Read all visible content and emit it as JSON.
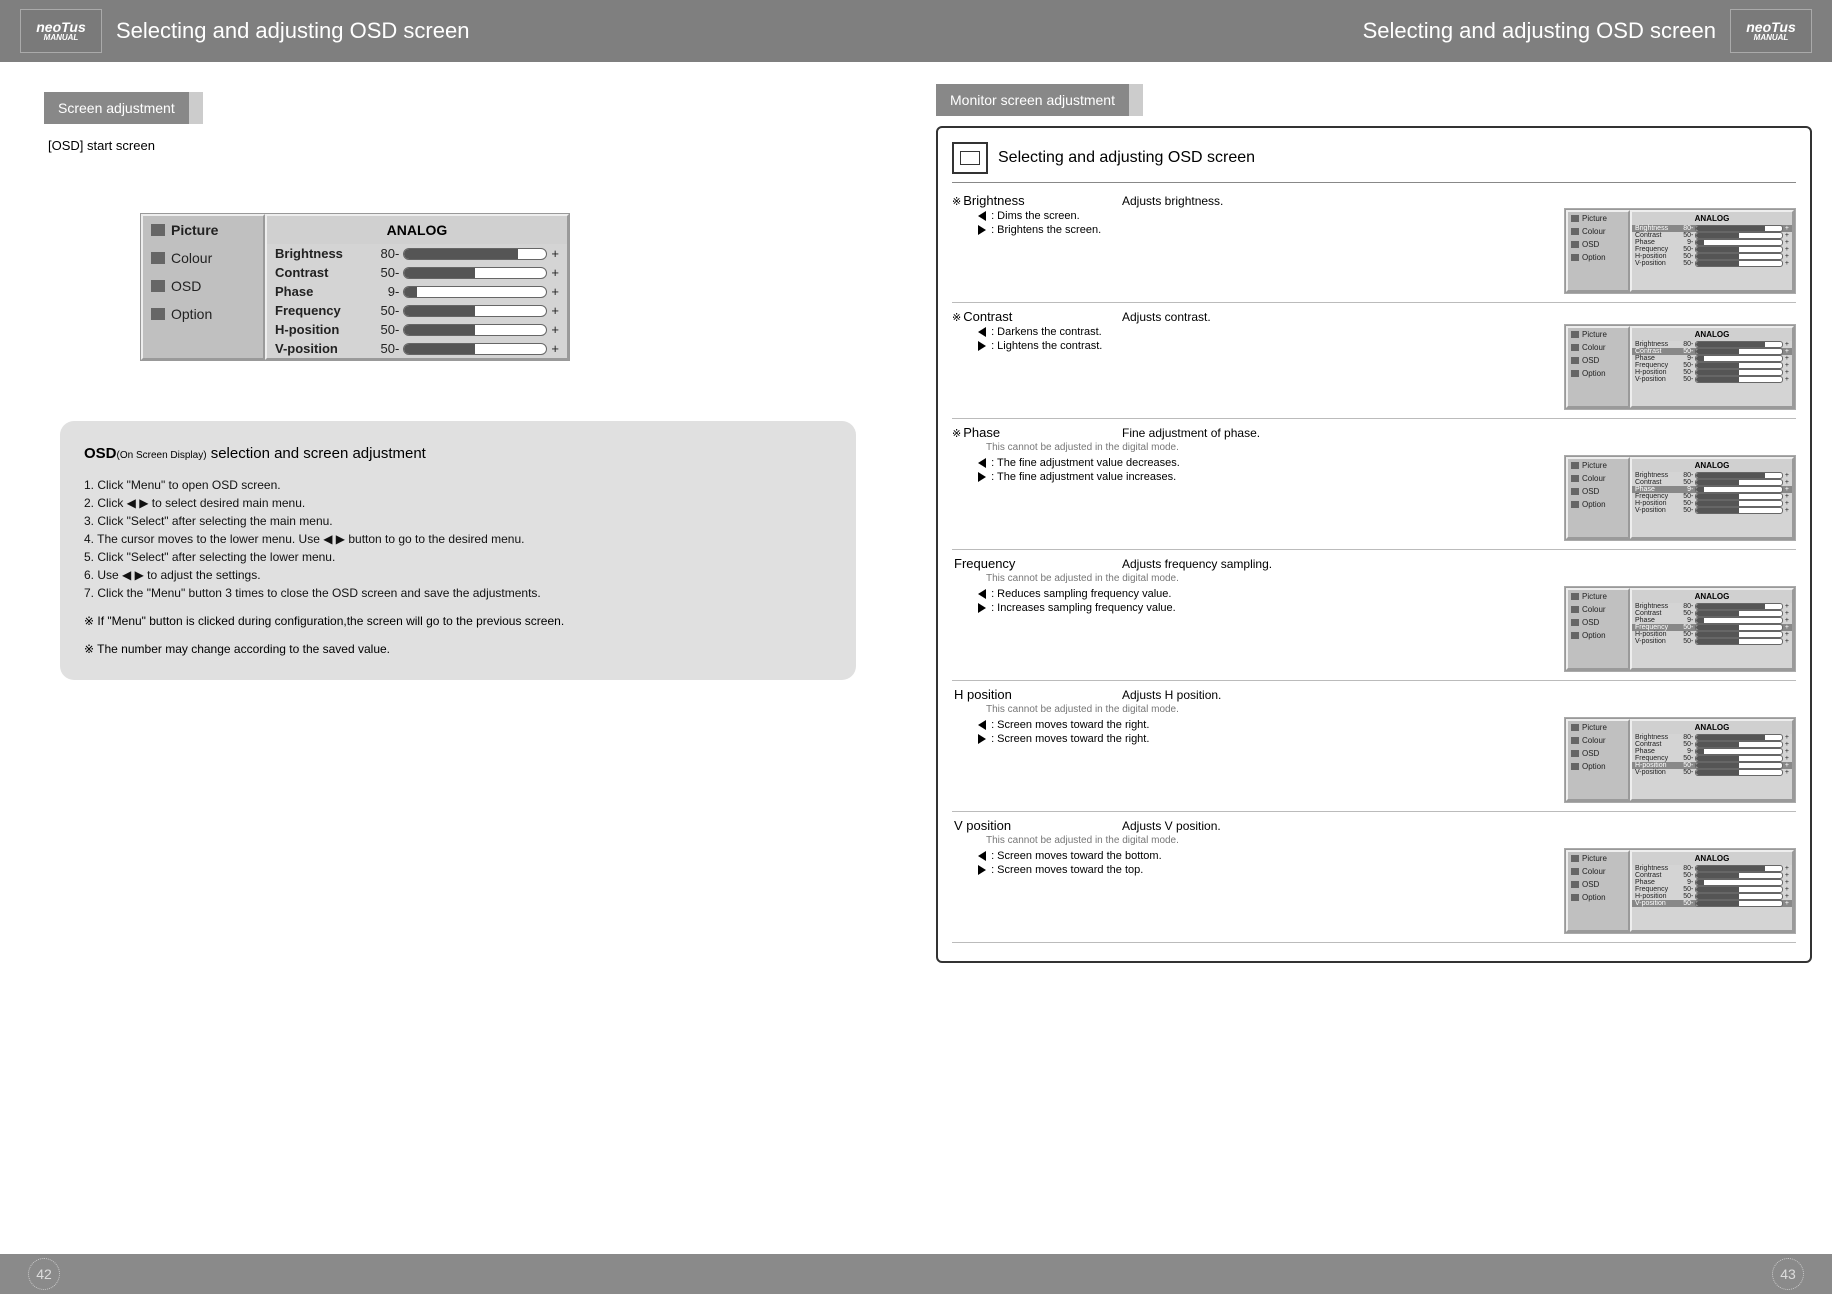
{
  "logo": {
    "brand": "neoTus",
    "sub": "MANUAL"
  },
  "header": {
    "left": "Selecting and adjusting OSD screen",
    "right": "Selecting and adjusting OSD screen"
  },
  "pagenum": {
    "left": "42",
    "right": "43"
  },
  "left_page": {
    "section": "Screen adjustment",
    "subtitle": "[OSD] start screen",
    "osd": {
      "menu": [
        "Picture",
        "Colour",
        "OSD",
        "Option"
      ],
      "analog": "ANALOG",
      "rows": [
        {
          "label": "Brightness",
          "value": "80"
        },
        {
          "label": "Contrast",
          "value": "50"
        },
        {
          "label": "Phase",
          "value": "9"
        },
        {
          "label": "Frequency",
          "value": "50"
        },
        {
          "label": "H-position",
          "value": "50"
        },
        {
          "label": "V-position",
          "value": "50"
        }
      ]
    },
    "instructions": {
      "heading_main": "OSD",
      "heading_sub": "(On Screen Display)",
      "heading_tail": " selection and screen adjustment",
      "steps": [
        "1. Click \"Menu\" to open OSD screen.",
        "2. Click ◀ ▶ to select desired main menu.",
        "3. Click \"Select\" after selecting the main menu.",
        "4. The cursor moves to the lower menu. Use ◀ ▶ button to go to the desired menu.",
        "5. Click \"Select\" after selecting the lower menu.",
        "6. Use ◀ ▶ to adjust the settings.",
        "7. Click the \"Menu\" button 3 times to close the OSD screen and save the adjustments."
      ],
      "notes": [
        "※ If \"Menu\" button is clicked during configuration,the screen will go to the previous screen.",
        "※ The number may change according to the saved value."
      ]
    }
  },
  "right_page": {
    "section": "Monitor screen adjustment",
    "panel_title": "Selecting and adjusting OSD screen",
    "digital_note": "This cannot be adjusted in the digital mode.",
    "settings": [
      {
        "name": "Brightness",
        "mark": "※",
        "desc": "Adjusts brightness.",
        "left": ": Dims the screen.",
        "right": ": Brightens the screen.",
        "hl": "Brightness",
        "note": false
      },
      {
        "name": "Contrast",
        "mark": "※",
        "desc": "Adjusts contrast.",
        "left": ": Darkens the contrast.",
        "right": ": Lightens the contrast.",
        "hl": "Contrast",
        "note": false
      },
      {
        "name": "Phase",
        "mark": "※",
        "desc": "Fine adjustment of phase.",
        "left": ": The fine adjustment value decreases.",
        "right": ": The fine adjustment value increases.",
        "hl": "Phase",
        "note": true
      },
      {
        "name": "Frequency",
        "mark": "",
        "desc": "Adjusts frequency sampling.",
        "left": ": Reduces sampling frequency value.",
        "right": ": Increases sampling frequency value.",
        "hl": "Frequency",
        "note": true
      },
      {
        "name": "H position",
        "mark": "",
        "desc": "Adjusts H position.",
        "left": ": Screen moves toward the right.",
        "right": ": Screen moves toward the right.",
        "hl": "H-position",
        "note": true
      },
      {
        "name": "V position",
        "mark": "",
        "desc": "Adjusts V position.",
        "left": ": Screen moves toward the bottom.",
        "right": ": Screen moves toward the top.",
        "hl": "V-position",
        "note": true
      }
    ]
  }
}
